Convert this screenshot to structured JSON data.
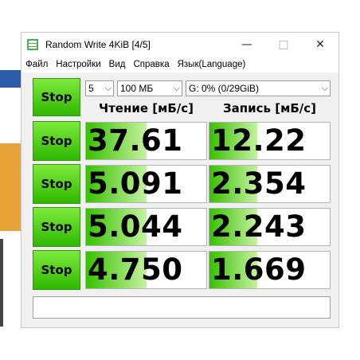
{
  "window": {
    "title": "Random Write 4KiB [4/5]",
    "minimize": "—",
    "maximize": "□",
    "close": "✕"
  },
  "menu": [
    "Файл",
    "Настройки",
    "Вид",
    "Справка",
    "Язык(Language)"
  ],
  "controls": {
    "count": "5",
    "size": "100 МБ",
    "drive": "G: 0% (0/29GiB)",
    "all_button": "Stop"
  },
  "headers": {
    "read": "Чтение [мБ/с]",
    "write": "Запись [мБ/с]"
  },
  "rows": [
    {
      "button": "Stop",
      "read": "37.61",
      "write": "12.22",
      "read_fill": 0.5,
      "write_fill": 0.4
    },
    {
      "button": "Stop",
      "read": "5.091",
      "write": "2.354",
      "read_fill": 0.5,
      "write_fill": 0.4
    },
    {
      "button": "Stop",
      "read": "5.044",
      "write": "2.243",
      "read_fill": 0.5,
      "write_fill": 0.4
    },
    {
      "button": "Stop",
      "read": "4.750",
      "write": "1.669",
      "read_fill": 0.5,
      "write_fill": 0.4
    }
  ],
  "status": "",
  "colors": {
    "button_green": "#2fb800",
    "bar_green": "#38c100"
  }
}
